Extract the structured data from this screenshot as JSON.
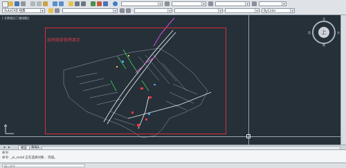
{
  "toolbar": {
    "workspace": "AutoCAD 经典",
    "layer": "",
    "color_value": "",
    "linetype": "",
    "lineweight": "",
    "plot_style": "ByColor",
    "style_combo": "",
    "dim_combo": ""
  },
  "viewport": {
    "label": "[-][俯视][二维线框]",
    "note": "此时线条依然显示"
  },
  "view_cube": {
    "center": "上",
    "north": "北",
    "south": "南",
    "west": "西",
    "east": "东"
  },
  "tabs": [
    {
      "label": "模型"
    },
    {
      "label": "布局1"
    }
  ],
  "command": {
    "line1": "命令:",
    "line2": "命令: _ai_selall 正在选择对象... 完成。"
  },
  "status": {
    "input_placeholder": "键入命令"
  },
  "colors": {
    "frame": "#d72f3a",
    "canvas": "#263039"
  }
}
